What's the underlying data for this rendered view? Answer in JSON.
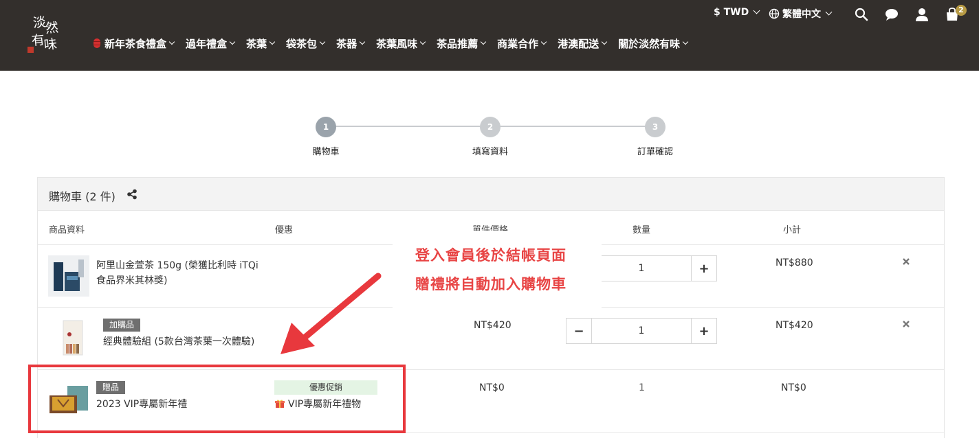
{
  "header": {
    "logo_text": "淡然有味",
    "currency": "$ TWD",
    "language": "繁體中文",
    "cart_count": "2",
    "nav": [
      {
        "label": "新年茶食禮盒"
      },
      {
        "label": "過年禮盒"
      },
      {
        "label": "茶葉"
      },
      {
        "label": "袋茶包"
      },
      {
        "label": "茶器"
      },
      {
        "label": "茶葉風味"
      },
      {
        "label": "茶品推薦"
      },
      {
        "label": "商業合作"
      },
      {
        "label": "港澳配送"
      },
      {
        "label": "關於淡然有味"
      }
    ]
  },
  "steps": [
    {
      "number": "1",
      "label": "購物車"
    },
    {
      "number": "2",
      "label": "填寫資料"
    },
    {
      "number": "3",
      "label": "訂單確認"
    }
  ],
  "cart": {
    "title": "購物車 (2 件)",
    "columns": {
      "product": "商品資料",
      "discount": "優惠",
      "unit_price": "單件價格",
      "quantity": "數量",
      "subtotal": "小計"
    },
    "items": [
      {
        "tag": "",
        "name": "阿里山金萱茶 150g (榮獲比利時 iTQi 食品界米其林獎)",
        "unit_price": "",
        "quantity": "1",
        "subtotal": "NT$880"
      },
      {
        "tag": "加購品",
        "name": "經典體驗組 (5款台灣茶葉一次體驗)",
        "unit_price": "NT$420",
        "quantity": "1",
        "subtotal": "NT$420"
      },
      {
        "tag": "贈品",
        "name": "2023 VIP專屬新年禮",
        "promo_label": "優惠促銷",
        "promo_text": "VIP專屬新年禮物",
        "unit_price": "NT$0",
        "quantity": "1",
        "subtotal": "NT$0"
      }
    ]
  },
  "annotation": {
    "line1": "登入會員後於結帳頁面",
    "line2": "贈禮將自動加入購物車"
  },
  "colors": {
    "header_bg": "#332f2c",
    "annotation_red": "#e84545",
    "badge_gold": "#b79a44",
    "promo_green_bg": "#e4f4e4"
  }
}
